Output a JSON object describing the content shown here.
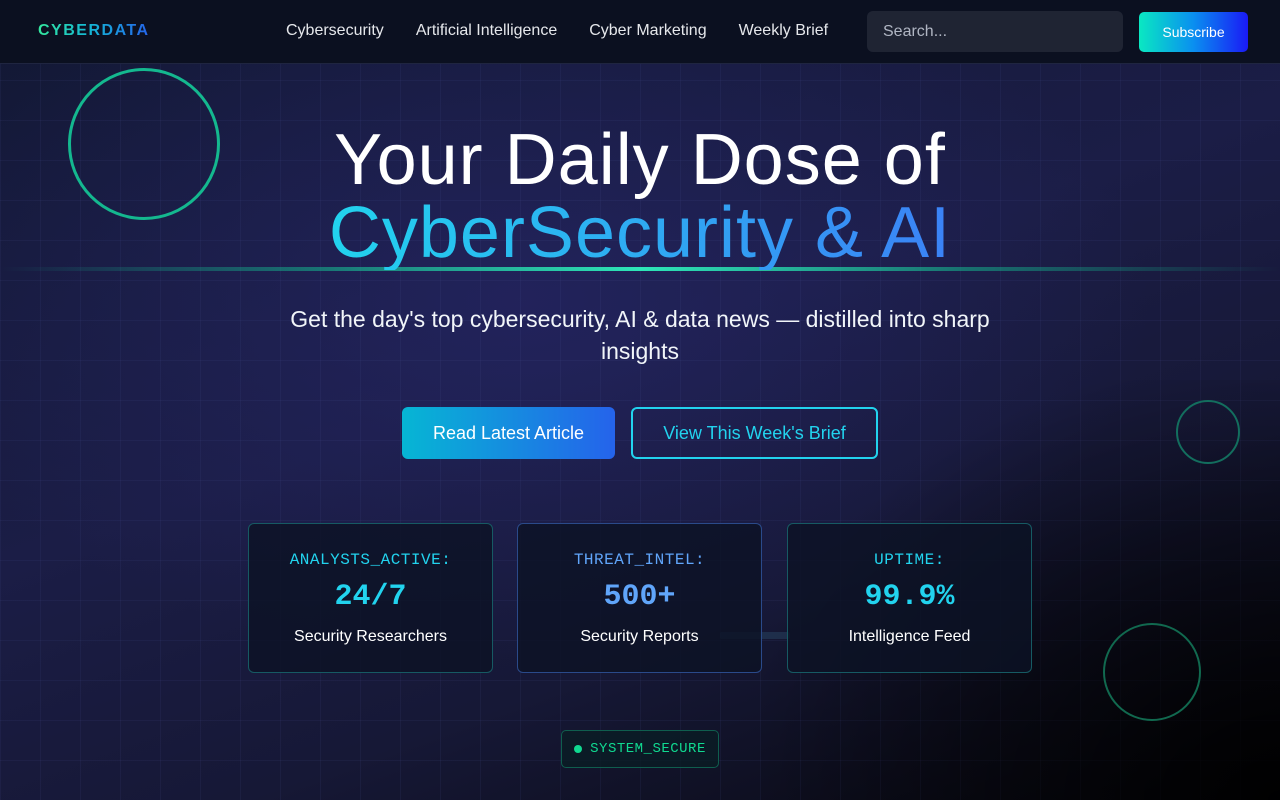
{
  "brand": {
    "logo_text": "CYBERDATA"
  },
  "nav": {
    "items": [
      {
        "label": "Cybersecurity"
      },
      {
        "label": "Artificial Intelligence"
      },
      {
        "label": "Cyber Marketing"
      },
      {
        "label": "Weekly Brief"
      }
    ]
  },
  "search": {
    "placeholder": "Search...",
    "value": ""
  },
  "header": {
    "subscribe_label": "Subscribe"
  },
  "hero": {
    "title_line_1": "Your Daily Dose of",
    "title_line_2": "CyberSecurity & AI",
    "subtitle": "Get the day's top cybersecurity, AI & data news — distilled into sharp insights",
    "primary_cta": "Read Latest Article",
    "secondary_cta": "View This Week's Brief"
  },
  "stats": [
    {
      "label": "ANALYSTS_ACTIVE:",
      "value": "24/7",
      "description": "Security Researchers"
    },
    {
      "label": "THREAT_INTEL:",
      "value": "500+",
      "description": "Security Reports"
    },
    {
      "label": "UPTIME:",
      "value": "99.9%",
      "description": "Intelligence Feed"
    }
  ],
  "status": {
    "text": "SYSTEM_SECURE",
    "color": "#10d990"
  },
  "colors": {
    "accent_cyan": "#22d3ee",
    "accent_blue": "#3b82f6",
    "accent_green": "#14b88f",
    "background": "#1b1d46"
  }
}
